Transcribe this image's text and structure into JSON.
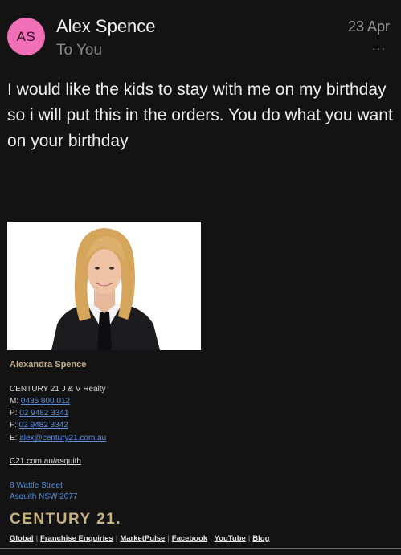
{
  "email": {
    "avatar_initials": "AS",
    "sender": "Alex Spence",
    "recipient": "To You",
    "date": "23 Apr",
    "more": "···",
    "body": "I would like the kids to stay with me on my birthday so i will put this in the orders. You do what you want on your birthday"
  },
  "signature": {
    "name": "Alexandra Spence",
    "company": "CENTURY 21 J & V Realty",
    "mobile_label": "M:",
    "mobile": "0435 800 012",
    "phone_label": "P:",
    "phone": "02 9482 3341",
    "fax_label": "F:",
    "fax": "02 9482 3342",
    "email_label": "E:",
    "email": "alex@century21.com.au",
    "website": "C21.com.au/asquith",
    "address_line1": "8 Wattle Street",
    "address_line2": "Asquith NSW 2077",
    "logo": "CENTURY 21.",
    "footer_links": [
      "Global",
      "Franchise Enquiries",
      "MarketPulse",
      "Facebook",
      "YouTube",
      "Blog"
    ]
  },
  "colors": {
    "avatar": "#f06fb6",
    "link": "#5b8fd9",
    "brand_gold": "#c7b17f"
  }
}
